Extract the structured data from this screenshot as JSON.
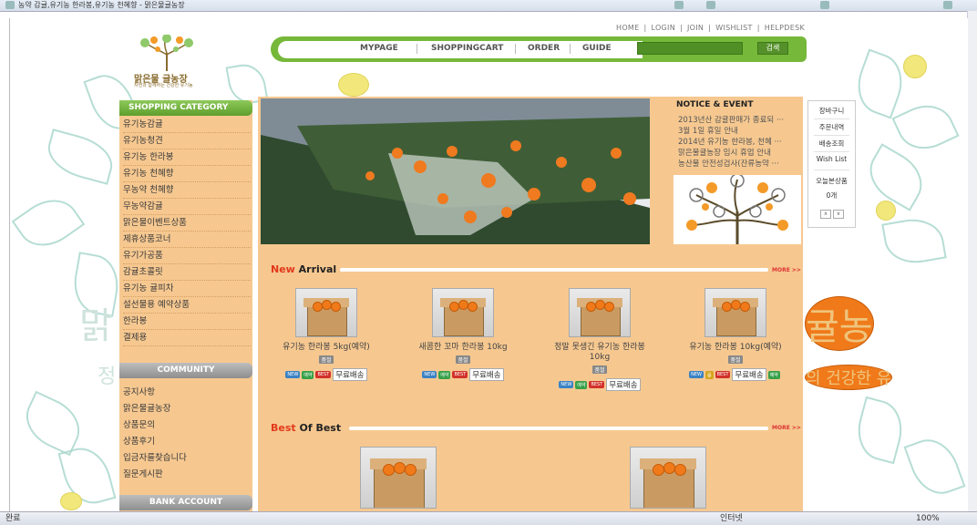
{
  "browser": {
    "tab_title": "농약 감귤,유기농 한라봉,유기농 천혜향 - 맑은물귤농장",
    "status_left": "완료",
    "status_zone": "인터넷",
    "zoom": "100%"
  },
  "header": {
    "topnav": [
      "HOME",
      "LOGIN",
      "JOIN",
      "WISHLIST",
      "HELPDESK"
    ],
    "logo_text": "맑은물 귤농장",
    "logo_sub": "자연과 함께하는 건강한 유기농",
    "menu": [
      "MYPAGE",
      "SHOPPINGCART",
      "ORDER",
      "GUIDE"
    ],
    "search_button": "검색",
    "search_value": ""
  },
  "sidebar": {
    "category_title": "SHOPPING CATEGORY",
    "categories": [
      "유기농감귤",
      "유기농청견",
      "유기농 한라봉",
      "유기농 천혜향",
      "무농약 천혜향",
      "무농약감귤",
      "맑은물이벤트상품",
      "제휴상품코너",
      "유기가공품",
      "감귤초콜릿",
      "유기농 귤피차",
      "설선물용 예약상품",
      "한라봉",
      "결제용"
    ],
    "community_title": "COMMUNITY",
    "community": [
      "공지사항",
      "맑은물귤농장",
      "상품문의",
      "상품후기",
      "입금자를찾습니다",
      "질문게시판"
    ],
    "bank_title": "BANK ACCOUNT"
  },
  "notice": {
    "title": "NOTICE & EVENT",
    "items": [
      "2013년산 감귤판매가 종료되 ···",
      "3월 1일 휴일 안내",
      "2014년 유기농 한라봉, 천혜 ···",
      "맑은물귤농장 임시 휴업 안내",
      "농산물 안전성검사(잔류농약 ···"
    ]
  },
  "quick_menu": {
    "items": [
      "장바구니",
      "주문내역",
      "배송조회",
      "Wish List"
    ],
    "today_title": "오늘본상품",
    "today_count": "0개",
    "up": "∧",
    "down": "∨"
  },
  "new_arrival": {
    "title_red": "New",
    "title_dark": " Arrival",
    "more": "MORE >>",
    "products": [
      {
        "name": "유기농 한라봉 5kg(예약)",
        "tag": "품절",
        "badges": [
          "NEW",
          "예약",
          "BEST"
        ],
        "free": "무료배송",
        "extra_badge": ""
      },
      {
        "name": "새콤한 꼬마 한라봉 10kg",
        "tag": "품절",
        "badges": [
          "NEW",
          "예약",
          "BEST"
        ],
        "free": "무료배송",
        "extra_badge": ""
      },
      {
        "name": "정말 못생긴 유기농 한라봉 10kg",
        "tag": "품절",
        "badges": [
          "NEW",
          "예약",
          "BEST"
        ],
        "free": "무료배송",
        "extra_badge": ""
      },
      {
        "name": "유기농 한라봉 10kg(예약)",
        "tag": "품절",
        "badges": [
          "NEW",
          "옵",
          "BEST"
        ],
        "free": "무료배송",
        "extra_badge": "예약"
      }
    ]
  },
  "best_of_best": {
    "title_red": "Best",
    "title_dark": " Of Best",
    "more": "MORE >>"
  },
  "background_text": {
    "left": "맑",
    "right": "귤농",
    "left_small": "정",
    "right_small": "의 건강한 유"
  },
  "colors": {
    "accent_green": "#76b839",
    "content_bg": "#f6c890",
    "leaf": "#a9d7cc",
    "new_red": "#e2391b"
  }
}
